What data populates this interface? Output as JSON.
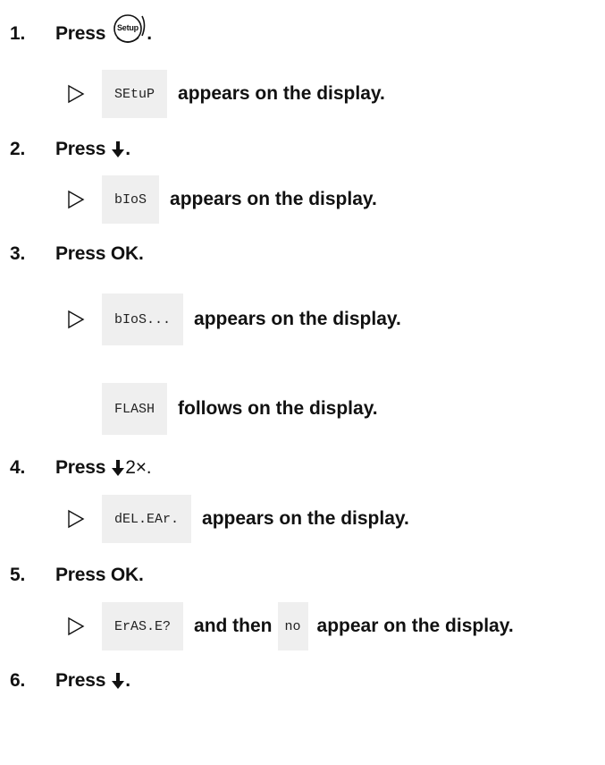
{
  "steps": [
    {
      "number": "1.",
      "text_before": "Press",
      "text_after": "."
    },
    {
      "number": "2.",
      "text_before": "Press",
      "text_after": "."
    },
    {
      "number": "3.",
      "text": "Press OK."
    },
    {
      "number": "4.",
      "text_before": "Press",
      "text_after": " 2×."
    },
    {
      "number": "5.",
      "text": "Press OK."
    },
    {
      "number": "6.",
      "text_before": "Press",
      "text_after": "."
    }
  ],
  "setup_key_label": "Setup",
  "results": [
    {
      "display": "SEtuP",
      "text": "appears on the display."
    },
    {
      "display": "bIoS",
      "text": "appears on the display."
    },
    {
      "display": "bIoS...",
      "text": "appears on the display."
    },
    {
      "display": "FLASH",
      "text": "follows on the display."
    },
    {
      "display": "dEL.EAr.",
      "text": "appears on the display."
    },
    {
      "display": "ErAS.E?",
      "text_middle": "and then",
      "display2": "no",
      "text": "appear on the display."
    }
  ]
}
